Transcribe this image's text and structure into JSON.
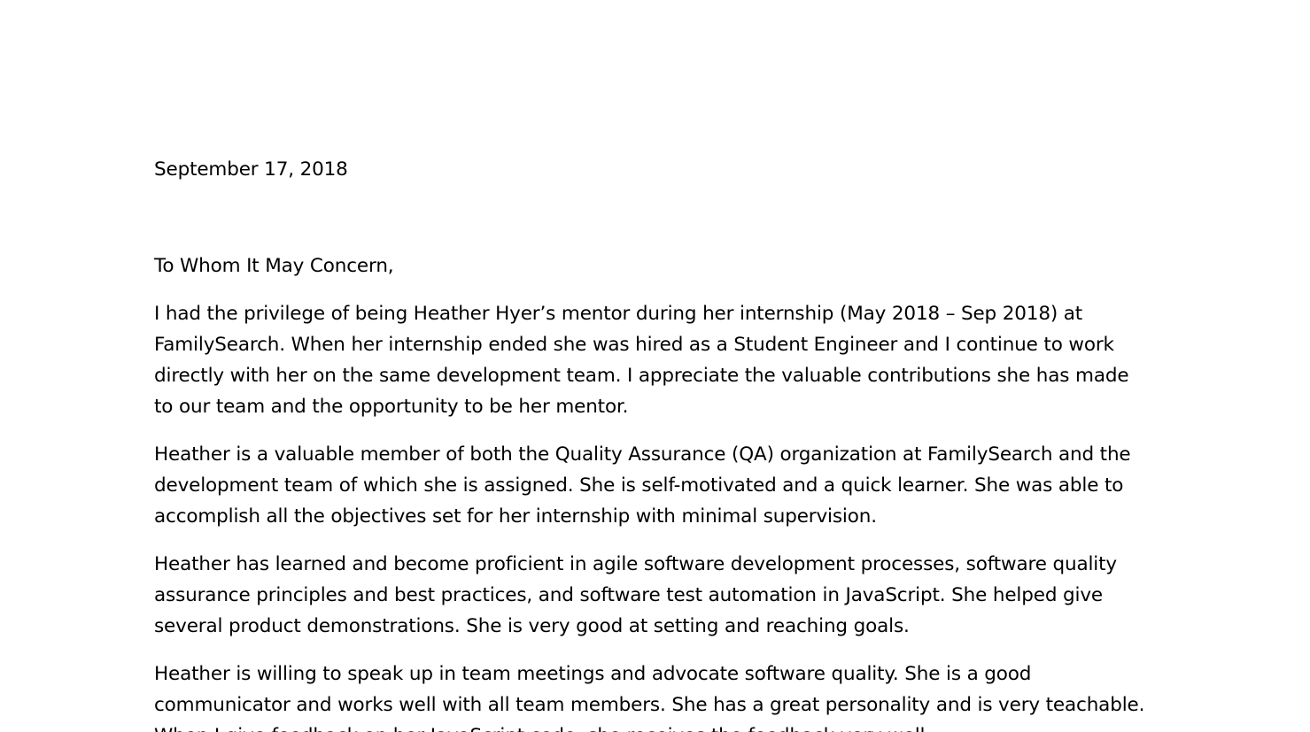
{
  "letter": {
    "date": "September 17, 2018",
    "salutation": "To Whom It May Concern,",
    "paragraphs": [
      [
        "I had the privilege of being Heather Hyer’s mentor during her internship (May 2018 – Sep 2018) at",
        "FamilySearch. When her internship ended she was hired as a Student Engineer and I continue to work",
        "directly with her on the same development team. I appreciate the valuable contributions she has made",
        "to our team and the opportunity to be her mentor."
      ],
      [
        "Heather is a valuable member of both the Quality Assurance (QA) organization at FamilySearch and the",
        "development team of which she is assigned. She is self-motivated and a quick learner. She was able to",
        "accomplish all the objectives set for her internship with minimal supervision."
      ],
      [
        "Heather has learned and become proficient in agile software development processes, software quality",
        "assurance principles and best practices, and software test automation in JavaScript. She helped give",
        "several product demonstrations. She is very good at setting and reaching goals."
      ],
      [
        "Heather is willing to speak up in team meetings and advocate software quality. She is a good",
        "communicator and works well with all team members. She has a great personality and is very teachable.",
        "When I give feedback on her JavaScript code, she receives the feedback very well."
      ]
    ]
  }
}
